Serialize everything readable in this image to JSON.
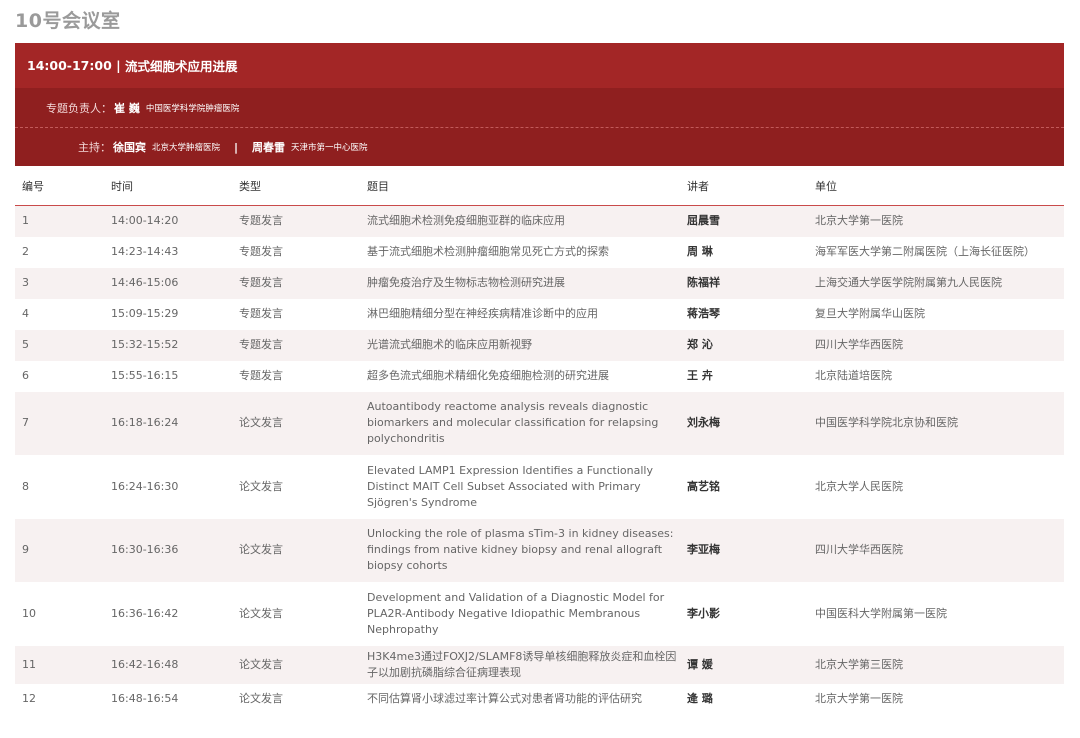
{
  "room": "10号会议室",
  "session": {
    "time": "14:00-17:00",
    "title": "流式细胞术应用进展",
    "leader_label": "专题负责人：",
    "leader_name": "崔  巍",
    "leader_org": "中国医学科学院肿瘤医院",
    "host_label": "主持：",
    "host1_name": "徐国宾",
    "host1_org": "北京大学肿瘤医院",
    "separator": "|",
    "host2_name": "周春雷",
    "host2_org": "天津市第一中心医院"
  },
  "columns": [
    "编号",
    "时间",
    "类型",
    "题目",
    "讲者",
    "单位"
  ],
  "rows": [
    {
      "no": "1",
      "time": "14:00-14:20",
      "type": "专题发言",
      "title": "流式细胞术检测免疫细胞亚群的临床应用",
      "speaker": "屈晨雪",
      "org": "北京大学第一医院",
      "h": "h1"
    },
    {
      "no": "2",
      "time": "14:23-14:43",
      "type": "专题发言",
      "title": "基于流式细胞术检测肿瘤细胞常见死亡方式的探索",
      "speaker": "周  琳",
      "org": "海军军医大学第二附属医院（上海长征医院）",
      "h": "h1"
    },
    {
      "no": "3",
      "time": "14:46-15:06",
      "type": "专题发言",
      "title": "肿瘤免疫治疗及生物标志物检测研究进展",
      "speaker": "陈福祥",
      "org": "上海交通大学医学院附属第九人民医院",
      "h": "h1"
    },
    {
      "no": "4",
      "time": "15:09-15:29",
      "type": "专题发言",
      "title": "淋巴细胞精细分型在神经疾病精准诊断中的应用",
      "speaker": "蒋浩琴",
      "org": "复旦大学附属华山医院",
      "h": "h1"
    },
    {
      "no": "5",
      "time": "15:32-15:52",
      "type": "专题发言",
      "title": "光谱流式细胞术的临床应用新视野",
      "speaker": "郑  沁",
      "org": "四川大学华西医院",
      "h": "h1"
    },
    {
      "no": "6",
      "time": "15:55-16:15",
      "type": "专题发言",
      "title": "超多色流式细胞术精细化免疫细胞检测的研究进展",
      "speaker": "王  卉",
      "org": "北京陆道培医院",
      "h": "h1"
    },
    {
      "no": "7",
      "time": "16:18-16:24",
      "type": "论文发言",
      "title": "Autoantibody reactome analysis reveals diagnostic biomarkers and molecular classification for relapsing polychondritis",
      "speaker": "刘永梅",
      "org": "中国医学科学院北京协和医院",
      "h": "h3"
    },
    {
      "no": "8",
      "time": "16:24-16:30",
      "type": "论文发言",
      "title": "Elevated LAMP1 Expression Identifies a Functionally Distinct MAIT Cell Subset Associated with Primary Sjögren's Syndrome",
      "speaker": "高艺铭",
      "org": "北京大学人民医院",
      "h": "h3"
    },
    {
      "no": "9",
      "time": "16:30-16:36",
      "type": "论文发言",
      "title": "Unlocking the role of plasma sTim-3 in kidney diseases: findings from native kidney biopsy and renal allograft biopsy cohorts",
      "speaker": "李亚梅",
      "org": "四川大学华西医院",
      "h": "h3"
    },
    {
      "no": "10",
      "time": "16:36-16:42",
      "type": "论文发言",
      "title": "Development and Validation of a Diagnostic Model for PLA2R-Antibody Negative Idiopathic Membranous Nephropathy",
      "speaker": "李小影",
      "org": "中国医科大学附属第一医院",
      "h": "h3"
    },
    {
      "no": "11",
      "time": "16:42-16:48",
      "type": "论文发言",
      "title": "H3K4me3通过FOXJ2/SLAMF8诱导单核细胞释放炎症和血栓因子以加剧抗磷脂综合征病理表现",
      "speaker": "谭  媛",
      "org": "北京大学第三医院",
      "h": "h2"
    },
    {
      "no": "12",
      "time": "16:48-16:54",
      "type": "论文发言",
      "title": "不同估算肾小球滤过率计算公式对患者肾功能的评估研究",
      "speaker": "逄  璐",
      "org": "北京大学第一医院",
      "h": "h1"
    }
  ]
}
